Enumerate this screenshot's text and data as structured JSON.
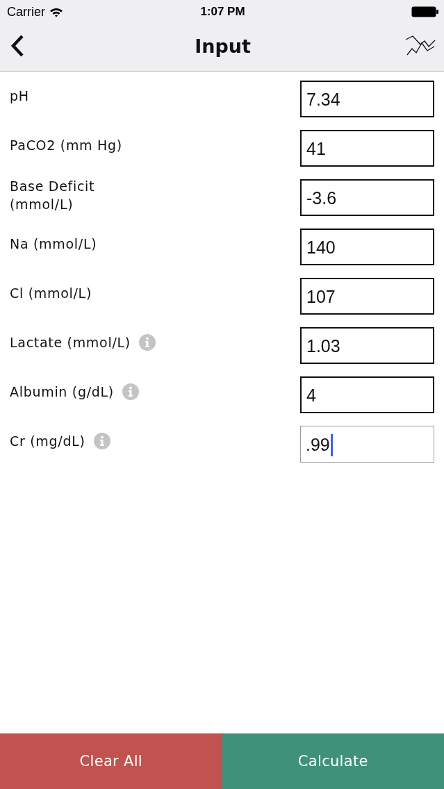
{
  "status_bar": {
    "carrier": "Carrier",
    "time": "1:07 PM"
  },
  "nav_bar": {
    "title": "Input"
  },
  "rows": [
    {
      "label": "pH",
      "value": "7.34",
      "info": false,
      "focused": false
    },
    {
      "label": "PaCO2 (mm Hg)",
      "value": "41",
      "info": false,
      "focused": false
    },
    {
      "label": "Base Deficit (mmol/L)",
      "value": "-3.6",
      "info": false,
      "focused": false
    },
    {
      "label": "Na (mmol/L)",
      "value": "140",
      "info": false,
      "focused": false
    },
    {
      "label": "Cl (mmol/L)",
      "value": "107",
      "info": false,
      "focused": false
    },
    {
      "label": "Lactate (mmol/L)",
      "value": "1.03",
      "info": true,
      "focused": false
    },
    {
      "label": "Albumin (g/dL)",
      "value": "4",
      "info": true,
      "focused": false
    },
    {
      "label": "Cr (mg/dL)",
      "value": ".99",
      "info": true,
      "focused": true
    }
  ],
  "buttons": [
    {
      "label": "Clear All",
      "color": "#c0524f"
    },
    {
      "label": "Calculate",
      "color": "#3f9278"
    }
  ]
}
